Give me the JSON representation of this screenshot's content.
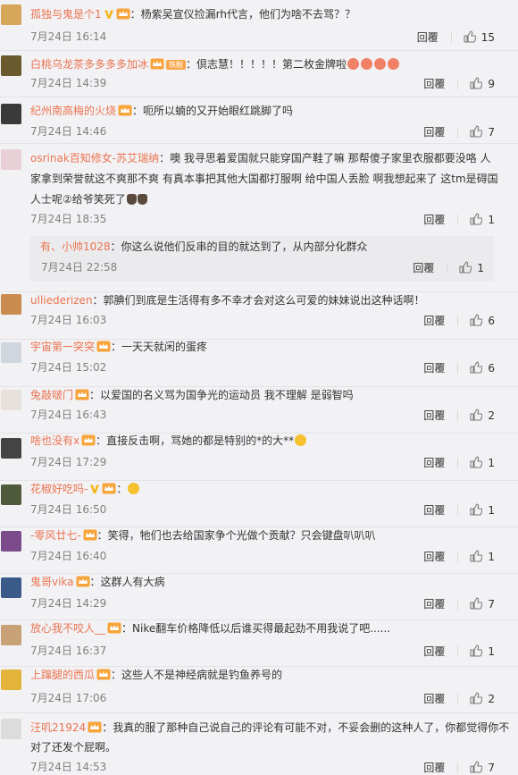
{
  "labels": {
    "reply": "回覆"
  },
  "comments": [
    {
      "user": "孤独与鬼是个1",
      "text": "：杨紫吴宣仪捡漏rh代言，他们为啥不去骂？？",
      "time": "7月24日 16:14",
      "likes": "15",
      "avatar_color": "#d6a65a"
    },
    {
      "user": "白桃乌龙茶多多多多加冰",
      "badge": "铁粉",
      "text": "：倶志慧！！！！！第二枚金牌啦",
      "time": "7月24日 14:39",
      "likes": "9",
      "avatar_color": "#6b5a2e"
    },
    {
      "user": "纪州南高梅的火烧",
      "text": "：呃所以蝻的又开始眼红跳脚了吗",
      "time": "7月24日 14:46",
      "likes": "7",
      "avatar_color": "#3a3a3a"
    },
    {
      "user": "osrinak百知修女-苏艾瑞纳",
      "text_lines": [
        "：噢 我寻思着爱国就只能穿国产鞋了嘛 那帮傻子家里衣服都要没咯 人",
        "家拿到荣誉就这不爽那不爽 有真本事把其他大国都打服啊 给中国人丢脸 啊我想起来了 这tm是碍国",
        "人士呢②给爷笑死了"
      ],
      "time": "7月24日 18:35",
      "likes": "1",
      "avatar_color": "#e9cfd6"
    },
    {
      "user": "ulliederizen",
      "text": "：郭腆们到底是生活得有多不幸才会对这么可爱的妹妹说出这种话啊！",
      "time": "7月24日 16:03",
      "likes": "6",
      "avatar_color": "#c98c4e"
    },
    {
      "user": "宇宙第一突突",
      "text": "：一天天就闲的蛋疼",
      "time": "7月24日 15:02",
      "likes": "6",
      "avatar_color": "#cfd6de"
    },
    {
      "user": "兔敲啵门",
      "text": "：以爱国的名义骂为国争光的运动员 我不理解 是弱智吗",
      "time": "7月24日 16:43",
      "likes": "2",
      "avatar_color": "#e8e0da"
    },
    {
      "user": "啥也没有x",
      "text": "：直接反击啊，骂她的都是特别的*的大**",
      "time": "7月24日 17:29",
      "likes": "1",
      "avatar_color": "#444444"
    },
    {
      "user": "花椒好吃吗-",
      "text": "：",
      "time": "7月24日 16:50",
      "likes": "1",
      "avatar_color": "#4f5a3a"
    },
    {
      "user": "-零风廿七-",
      "text": "：笑得，牠们也去给国家争个光做个贡献？只会键盘叭叭叭",
      "time": "7月24日 16:40",
      "likes": "1",
      "avatar_color": "#7a4a8a"
    },
    {
      "user": "鬼哥vika",
      "text": "：这群人有大病",
      "time": "7月24日 14:29",
      "likes": "7",
      "avatar_color": "#3a5a8a"
    },
    {
      "user": "放心我不咬人__",
      "text": "：Nike翻车价格降低以后谁买得最起劲不用我说了吧......",
      "time": "7月24日 16:37",
      "likes": "1",
      "avatar_color": "#c8a276"
    },
    {
      "user": "上蹿腿的西瓜",
      "text": "：这些人不是神经病就是钓鱼养号的",
      "time": "7月24日 17:06",
      "likes": "2",
      "avatar_color": "#e2b43a"
    },
    {
      "user": "汪叽21924",
      "text_lines": [
        "：我真的服了那种自己说自己的评论有可能不对，不妥会删的这种人了，你都觉得你不",
        "对了还发个屁啊。"
      ],
      "time": "7月24日 14:53",
      "likes": "7",
      "avatar_color": "#dcdcdc"
    }
  ],
  "nested_reply": {
    "user": "有、小帅1028",
    "text": "：你这么说他们反串的目的就达到了，从内部分化群众",
    "time": "7月24日 22:58",
    "likes": "1"
  }
}
